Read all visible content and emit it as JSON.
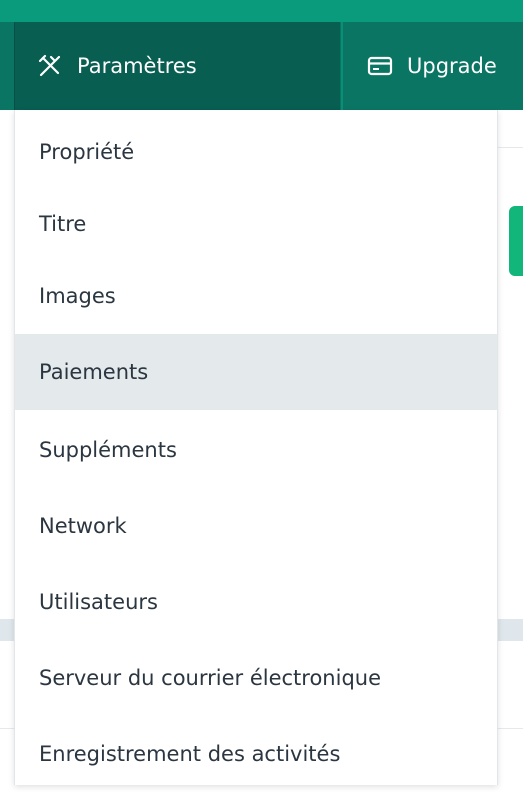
{
  "navbar": {
    "settings_label": "Paramètres",
    "upgrade_label": "Upgrade",
    "settings_icon": "tools-icon",
    "upgrade_icon": "credit-card-icon"
  },
  "dropdown": {
    "items": [
      {
        "label": "Propriété"
      },
      {
        "label": "Titre"
      },
      {
        "label": "Images"
      },
      {
        "label": "Paiements"
      },
      {
        "label": "Suppléments"
      },
      {
        "label": "Network"
      },
      {
        "label": "Utilisateurs"
      },
      {
        "label": "Serveur du courrier électronique"
      },
      {
        "label": "Enregistrement des activités"
      }
    ],
    "active_index": 3
  },
  "colors": {
    "topbar": "#0a9a7c",
    "navbar": "#0b7563",
    "navbar_active": "#075e51",
    "menu_hover": "#e4e9ec",
    "accent_green": "#12b67a"
  }
}
